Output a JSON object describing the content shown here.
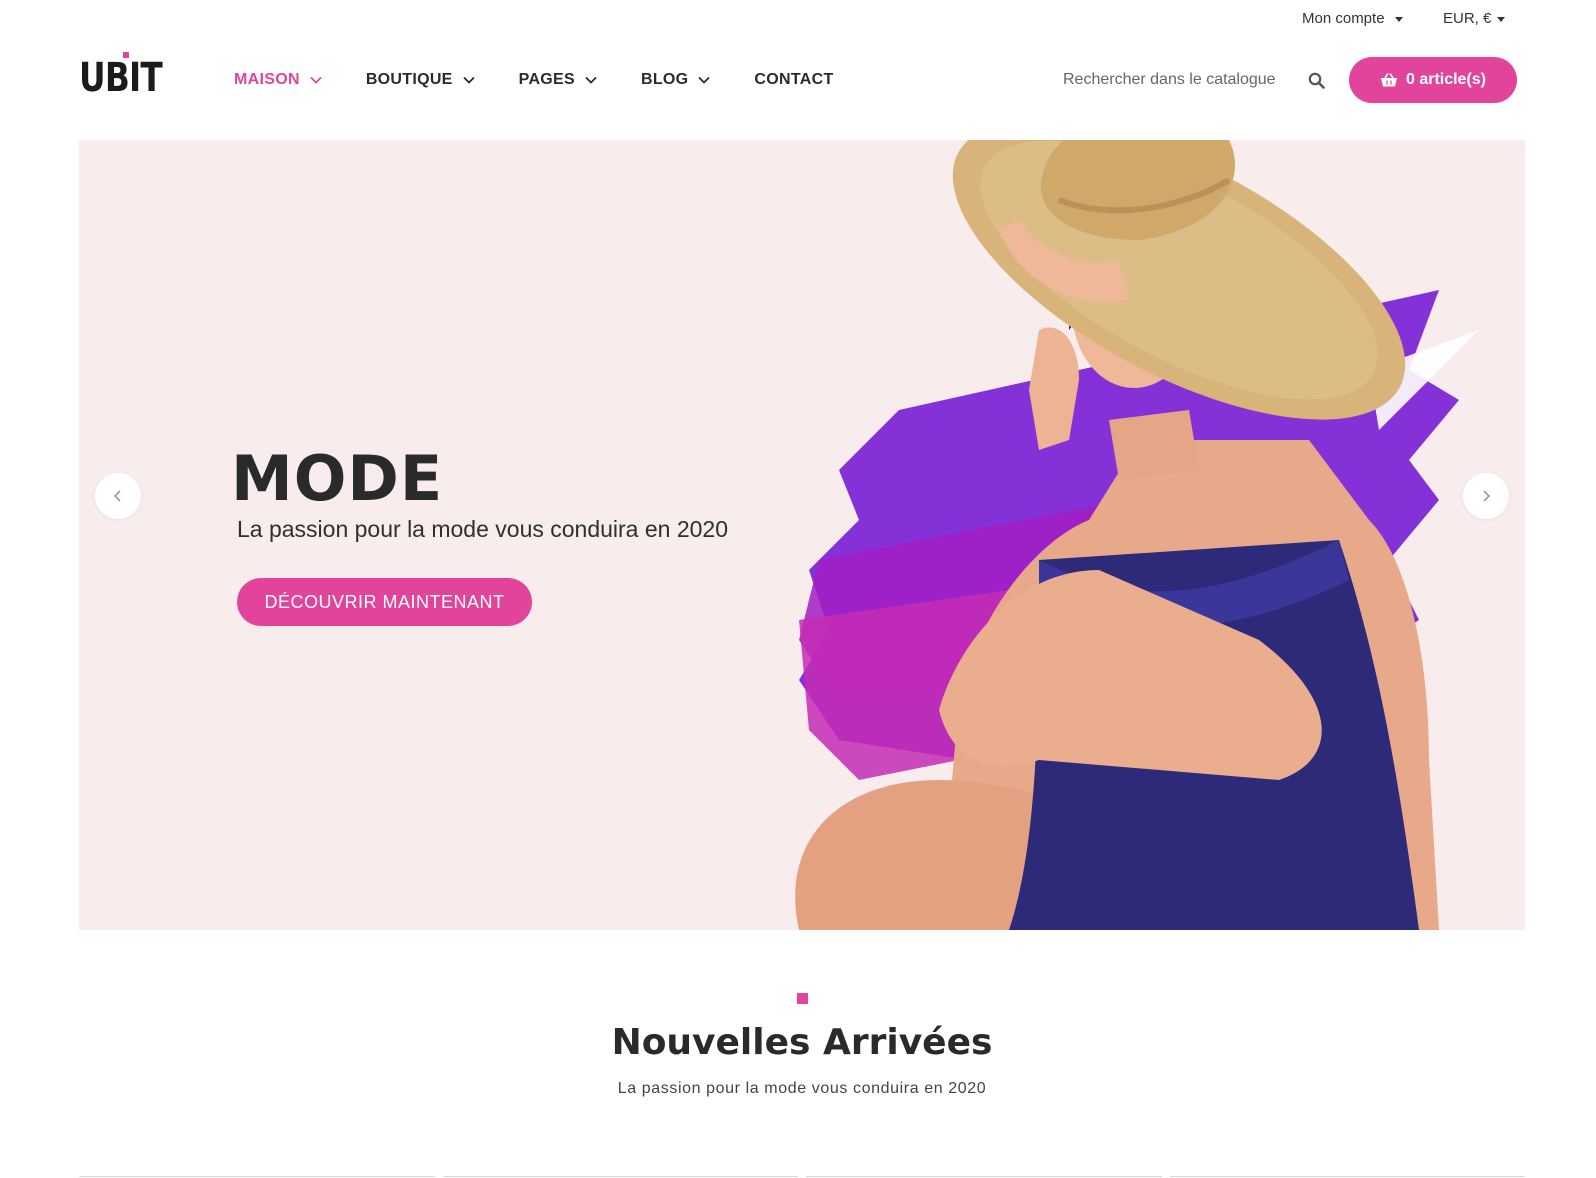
{
  "topbar": {
    "account_label": "Mon compte",
    "currency_label": "EUR, €"
  },
  "header": {
    "logo_text": "UBIT",
    "nav": [
      {
        "label": "MAISON",
        "active": true,
        "has_dropdown": true
      },
      {
        "label": "BOUTIQUE",
        "active": false,
        "has_dropdown": true
      },
      {
        "label": "PAGES",
        "active": false,
        "has_dropdown": true
      },
      {
        "label": "BLOG",
        "active": false,
        "has_dropdown": true
      },
      {
        "label": "CONTACT",
        "active": false,
        "has_dropdown": false
      }
    ],
    "search": {
      "placeholder": "Rechercher dans le catalogue",
      "value": ""
    },
    "cart_label": "0 article(s)"
  },
  "hero": {
    "title": "MODE",
    "subtitle": "La passion pour la mode vous conduira en 2020",
    "button_label": "DÉCOUVRIR MAINTENANT"
  },
  "section": {
    "title": "Nouvelles Arrivées",
    "subtitle": "La passion pour la mode vous conduira en 2020"
  },
  "icons": {
    "search": "search-icon",
    "cart": "basket-icon",
    "prev": "chevron-left-icon",
    "next": "chevron-right-icon",
    "dropdown": "chevron-down-icon"
  },
  "colors": {
    "accent": "#e2449c",
    "hero_bg": "#f8ecec",
    "text": "#2b2b2b",
    "swimsuit": "#2d2a7a",
    "brush_purple": "#7a22d6",
    "hat": "#d8b47a"
  }
}
